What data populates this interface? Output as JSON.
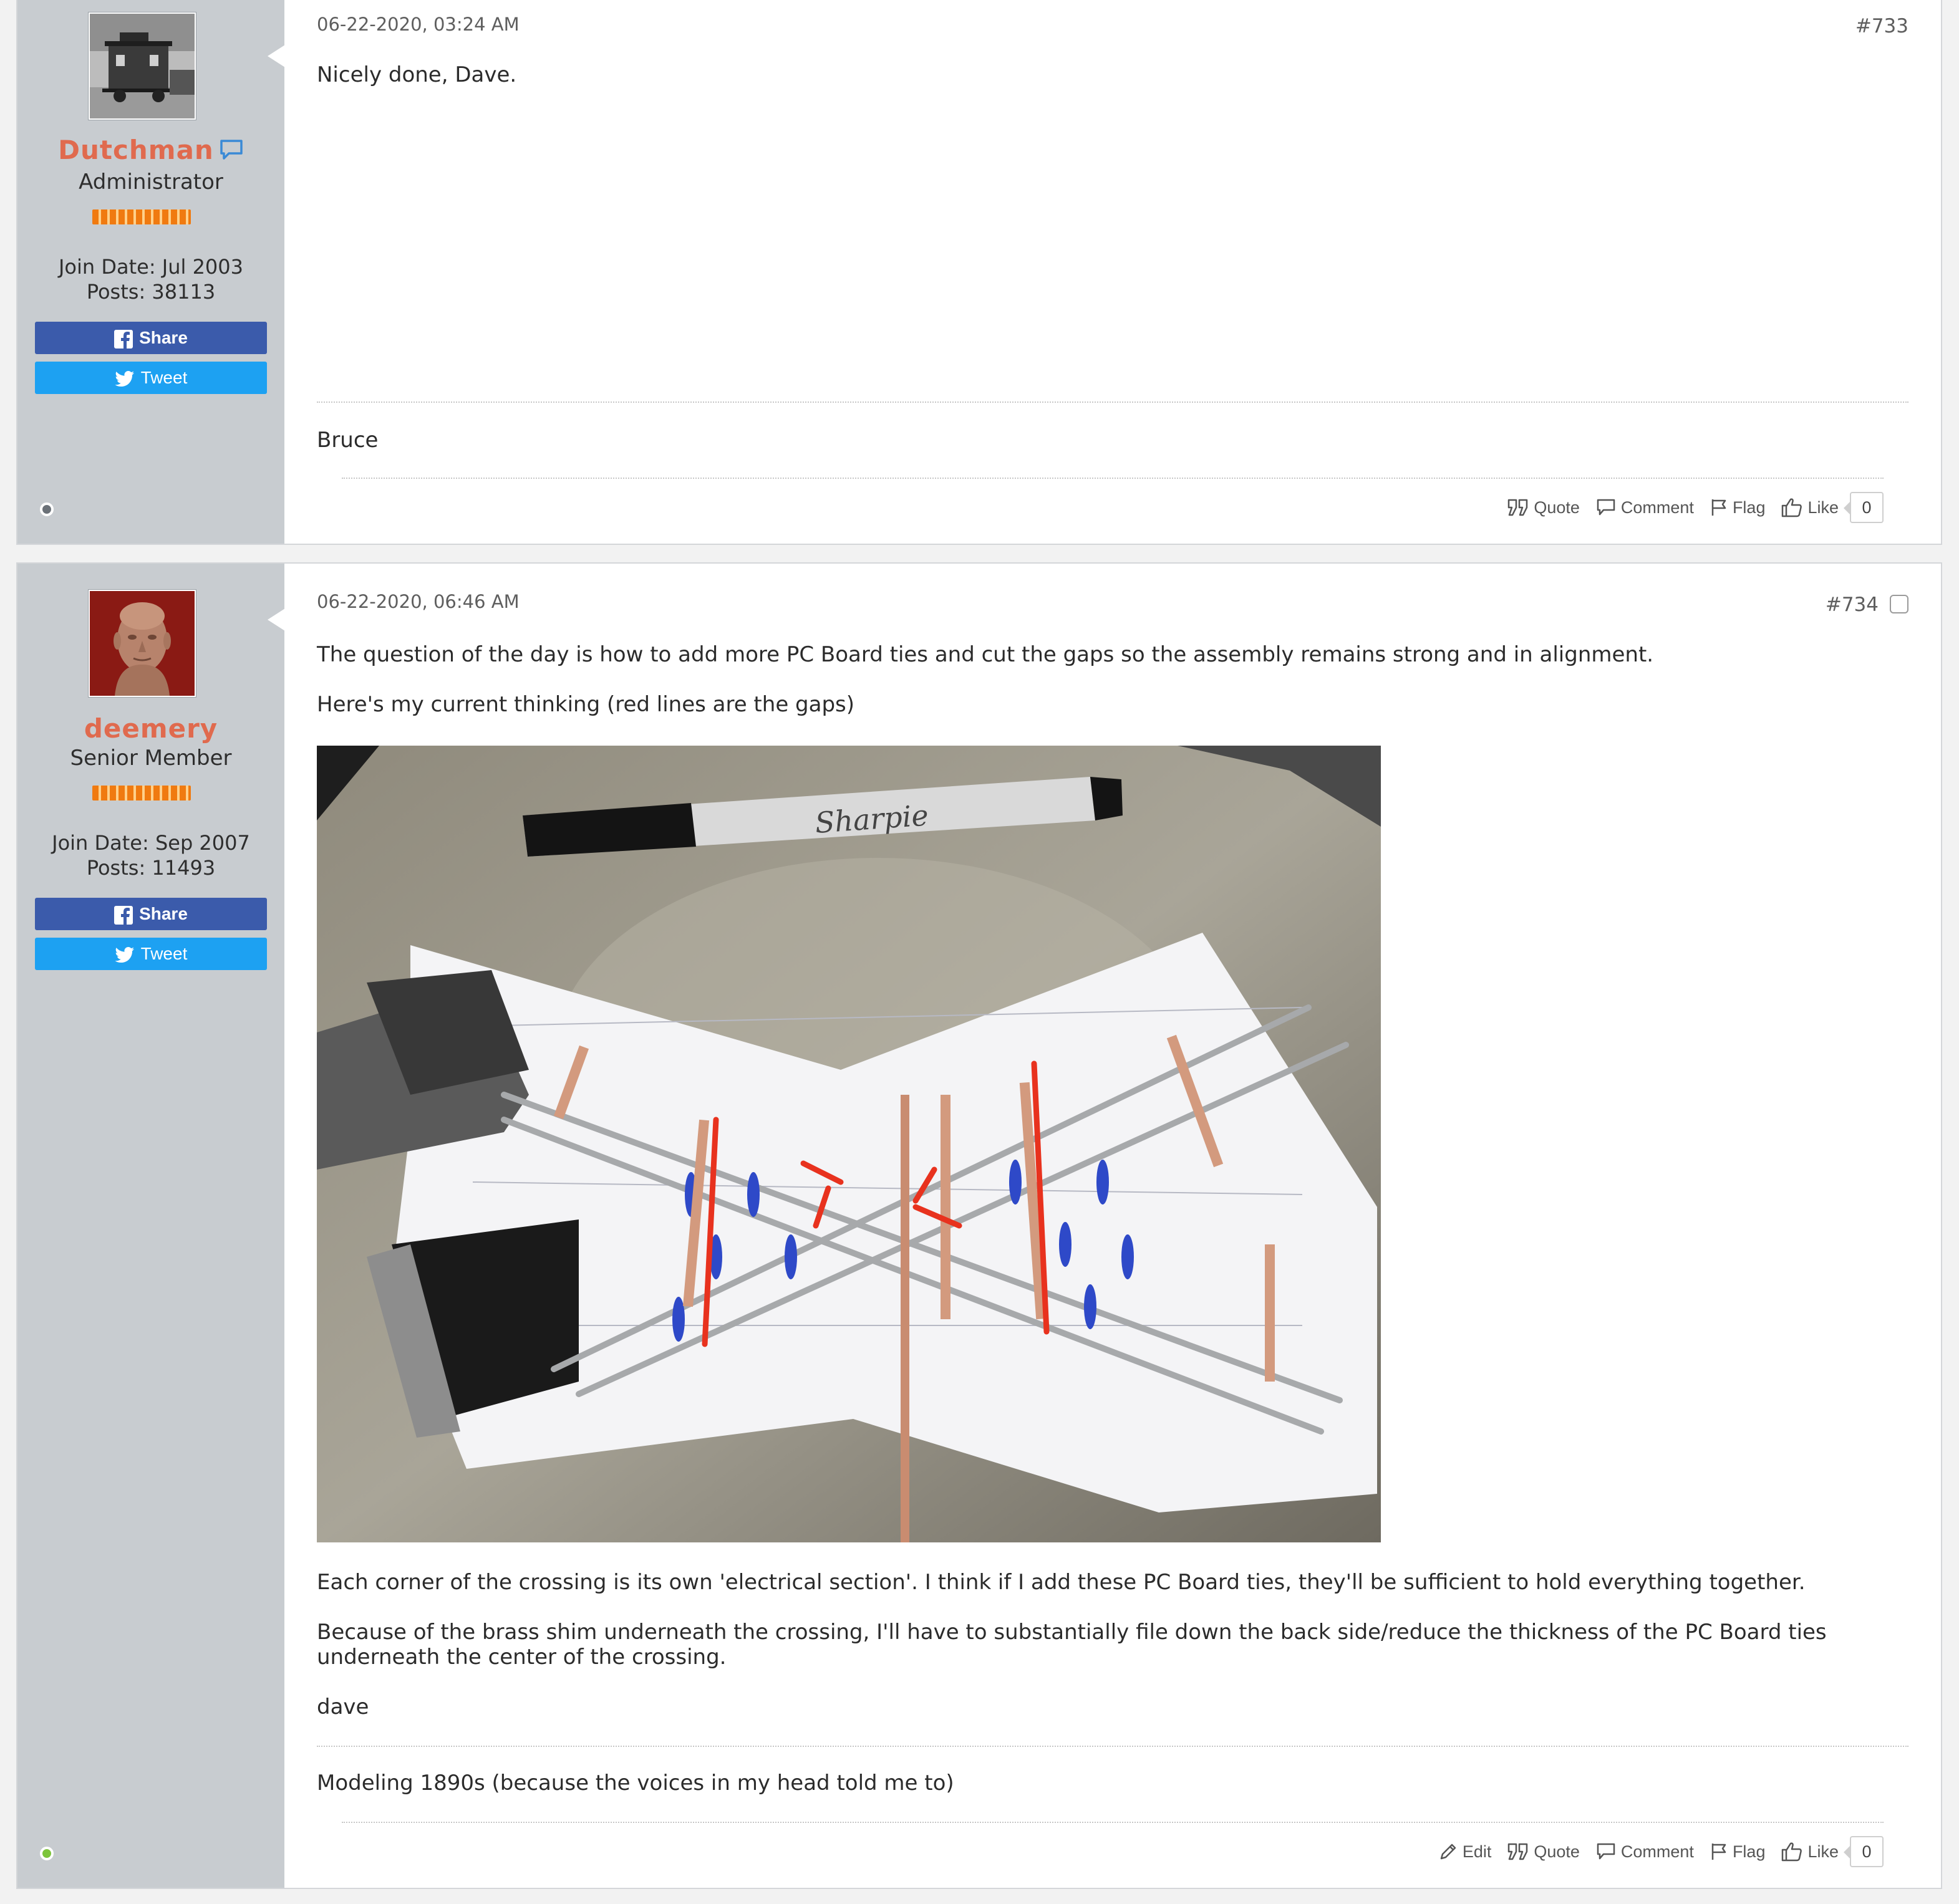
{
  "posts": [
    {
      "user": {
        "name": "Dutchman",
        "title": "Administrator",
        "join_date": "Join Date: Jul 2003",
        "posts": "Posts: 38113",
        "status": "offline",
        "avatar": "caboose-photo"
      },
      "share_label": "Share",
      "tweet_label": "Tweet",
      "date": "06-22-2020, 03:24 AM",
      "number": "#733",
      "body": [
        "Nicely done, Dave."
      ],
      "signature": "Bruce",
      "actions": {
        "quote": "Quote",
        "comment": "Comment",
        "flag": "Flag",
        "like": "Like",
        "like_count": "0"
      }
    },
    {
      "user": {
        "name": "deemery",
        "title": "Senior Member",
        "join_date": "Join Date: Sep 2007",
        "posts": "Posts: 11493",
        "status": "online",
        "avatar": "bust-sculpture-photo"
      },
      "share_label": "Share",
      "tweet_label": "Tweet",
      "date": "06-22-2020, 06:46 AM",
      "number": "#734",
      "body": [
        "The question of the day is how to add more PC Board ties and cut the gaps so the assembly remains strong and in alignment.",
        "Here's my current thinking (red lines are the gaps)",
        "Each corner of the crossing is its own 'electrical section'. I think if I add these PC Board ties, they'll be sufficient to hold everything together.",
        "Because of the brass shim underneath the crossing, I'll have to substantially file down the back side/reduce the thickness of the PC Board ties underneath the center of the crossing.",
        "dave"
      ],
      "photo_text": "Sharpie",
      "signature": "Modeling 1890s (because the voices in my head told me to)",
      "actions": {
        "edit": "Edit",
        "quote": "Quote",
        "comment": "Comment",
        "flag": "Flag",
        "like": "Like",
        "like_count": "0"
      }
    }
  ],
  "colors": {
    "username": "#e06a4e",
    "sidebar": "#c8ccd0",
    "facebook": "#3b5bab",
    "twitter": "#1da1f2",
    "online": "#7cc43a",
    "offline": "#6b7178"
  }
}
